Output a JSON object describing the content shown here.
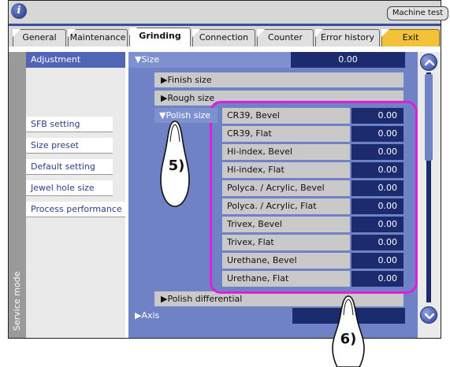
{
  "window": {
    "info_icon": "i",
    "machine_test": "Machine test"
  },
  "tabs": [
    {
      "label": "General"
    },
    {
      "label": "Maintenance"
    },
    {
      "label": "Grinding"
    },
    {
      "label": "Connection"
    },
    {
      "label": "Counter"
    },
    {
      "label": "Error history"
    },
    {
      "label": "Exit"
    }
  ],
  "sidebar": {
    "label": "Service mode"
  },
  "left_panel": {
    "header": "Adjustment",
    "items": [
      {
        "label": "SFB setting"
      },
      {
        "label": "Size preset"
      },
      {
        "label": "Default setting"
      },
      {
        "label": "Jewel hole size"
      },
      {
        "label": "Process performance"
      }
    ]
  },
  "size": {
    "label": "▼Size",
    "value": "0.00",
    "finish": "▶Finish size",
    "rough": "▶Rough size",
    "polish": "▼Polish size",
    "polish_differential": "▶Polish differential"
  },
  "polish_rows": [
    {
      "label": "CR39, Bevel",
      "value": "0.00"
    },
    {
      "label": "CR39, Flat",
      "value": "0.00"
    },
    {
      "label": "Hi-index, Bevel",
      "value": "0.00"
    },
    {
      "label": "Hi-index, Flat",
      "value": "0.00"
    },
    {
      "label": "Polyca. / Acrylic, Bevel",
      "value": "0.00"
    },
    {
      "label": "Polyca. / Acrylic, Flat",
      "value": "0.00"
    },
    {
      "label": "Trivex, Bevel",
      "value": "0.00"
    },
    {
      "label": "Trivex, Flat",
      "value": "0.00"
    },
    {
      "label": "Urethane, Bevel",
      "value": "0.00"
    },
    {
      "label": "Urethane, Flat",
      "value": "0.00"
    }
  ],
  "axis": {
    "label": "▶Axis"
  },
  "callouts": {
    "step5": "5)",
    "step6": "6)"
  },
  "colors": {
    "accent": "#5065b5",
    "value_bg": "#1b2b6e",
    "highlight": "#e020d8",
    "exit": "#f4c23a"
  }
}
